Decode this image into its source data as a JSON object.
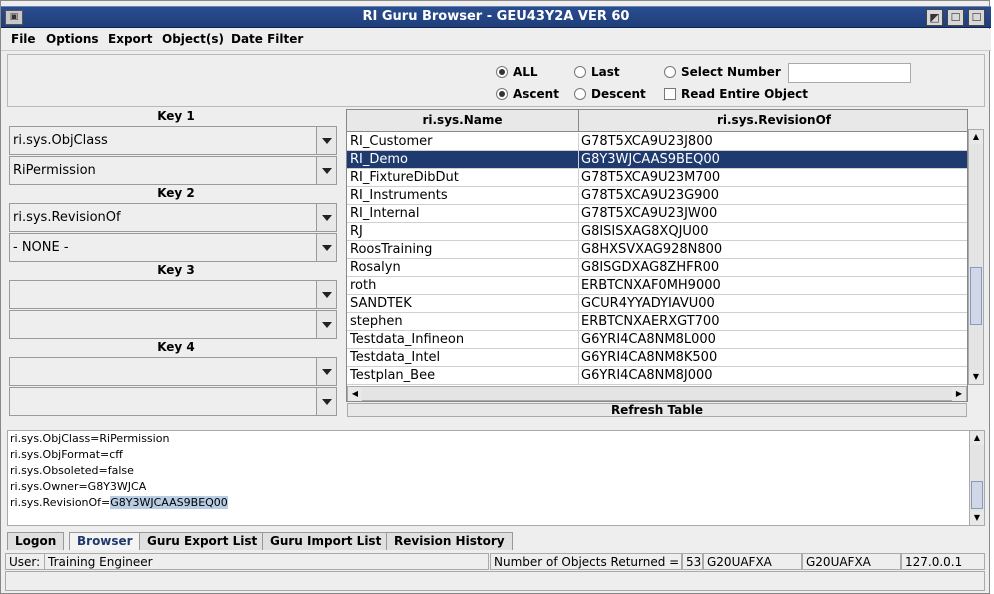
{
  "window": {
    "title": "RI Guru Browser - GEU43Y2A  VER 60",
    "sysmenu_icon": "window-menu-icon",
    "controls": [
      "minimize",
      "maximize",
      "close"
    ]
  },
  "menu": [
    "File",
    "Options",
    "Export",
    "Object(s)",
    "Date Filter"
  ],
  "options": {
    "all_label": "ALL",
    "last_label": "Last",
    "select_number_label": "Select Number",
    "select_number_value": "",
    "ascent_label": "Ascent",
    "descent_label": "Descent",
    "read_entire_label": "Read Entire Object",
    "selected_count_mode": "ALL",
    "selected_order": "Ascent",
    "read_entire_checked": false
  },
  "keys": {
    "key1_label": "Key 1",
    "key1_field": "ri.sys.ObjClass",
    "key1_value": "RiPermission",
    "key2_label": "Key 2",
    "key2_field": "ri.sys.RevisionOf",
    "key2_value": "- NONE -",
    "key3_label": "Key 3",
    "key3_field": "",
    "key3_value": "",
    "key4_label": "Key 4",
    "key4_field": "",
    "key4_value": ""
  },
  "table": {
    "columns": [
      "ri.sys.Name",
      "ri.sys.RevisionOf"
    ],
    "rows": [
      [
        "RI_Customer",
        "G78T5XCA9U23J800"
      ],
      [
        "RI_Demo",
        "G8Y3WJCAAS9BEQ00"
      ],
      [
        "RI_FixtureDibDut",
        "G78T5XCA9U23M700"
      ],
      [
        "RI_Instruments",
        "G78T5XCA9U23G900"
      ],
      [
        "RI_Internal",
        "G78T5XCA9U23JW00"
      ],
      [
        "RJ",
        "G8ISISXAG8XQJU00"
      ],
      [
        "RoosTraining",
        "G8HXSVXAG928N800"
      ],
      [
        "Rosalyn",
        "G8ISGDXAG8ZHFR00"
      ],
      [
        "roth",
        "ERBTCNXAF0MH9000"
      ],
      [
        "SANDTEK",
        "GCUR4YYADYIAVU00"
      ],
      [
        "stephen",
        "ERBTCNXAERXGT700"
      ],
      [
        "Testdata_Infineon",
        "G6YRI4CA8NM8L000"
      ],
      [
        "Testdata_Intel",
        "G6YRI4CA8NM8K500"
      ],
      [
        "Testplan_Bee",
        "G6YRI4CA8NM8J000"
      ]
    ],
    "selected_row": 1,
    "refresh_label": "Refresh Table"
  },
  "details": {
    "lines": [
      "ri.sys.ObjClass=RiPermission",
      "ri.sys.ObjFormat=cff",
      "ri.sys.Obsoleted=false",
      "ri.sys.Owner=G8Y3WJCA",
      "ri.sys.RevisionOf="
    ],
    "highlighted": "G8Y3WJCAAS9BEQ00"
  },
  "tabs": [
    "Logon",
    "Browser",
    "Guru Export List",
    "Guru Import List",
    "Revision History"
  ],
  "active_tab": "Browser",
  "status": {
    "user_label": "User:",
    "user_value": "Training Engineer",
    "objects_label": "Number of Objects Returned =",
    "objects_count": "53",
    "host1": "G20UAFXA",
    "host2": "G20UAFXA",
    "ip": "127.0.0.1"
  },
  "colors": {
    "titlebar": "#1f3e7a",
    "selection": "#1f3a6e",
    "highlight": "#b8cce4"
  }
}
